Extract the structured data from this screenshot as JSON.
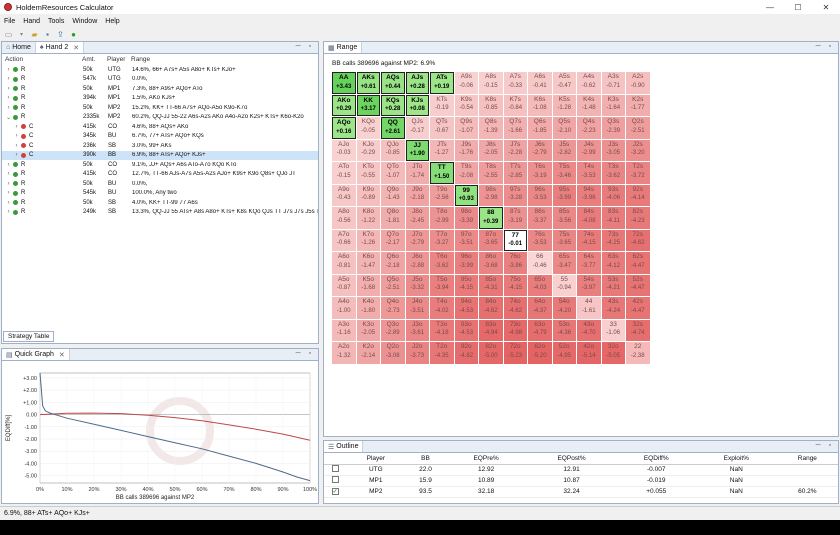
{
  "window": {
    "title": "HoldemResources Calculator",
    "min": "—",
    "max": "☐",
    "close": "✕"
  },
  "menu": [
    "File",
    "Hand",
    "Tools",
    "Window",
    "Help"
  ],
  "left_panel": {
    "tabs": [
      {
        "label": "Home"
      },
      {
        "label": "Hand 2"
      }
    ],
    "columns": [
      "Action",
      "Amt.",
      "Player",
      "Range"
    ],
    "rows": [
      {
        "exp": "›",
        "dot": "#3a9a3a",
        "action": "R",
        "amt": "50k",
        "player": "UTG",
        "range": "14.6%, 66+ A7s+ A5s A8o+ KTs+ KJo+",
        "depth": 0,
        "sel": false
      },
      {
        "exp": "›",
        "dot": "#3a9a3a",
        "action": "R",
        "amt": "547k",
        "player": "UTG",
        "range": "0.0%,",
        "depth": 0,
        "sel": false
      },
      {
        "exp": "›",
        "dot": "#3a9a3a",
        "action": "R",
        "amt": "50k",
        "player": "MP1",
        "range": "7.3%, 88+ A9s+ AQo+ ATo",
        "depth": 0,
        "sel": false
      },
      {
        "exp": "›",
        "dot": "#3a9a3a",
        "action": "R",
        "amt": "394k",
        "player": "MP1",
        "range": "1.5%, AKo KJs+",
        "depth": 0,
        "sel": false
      },
      {
        "exp": "›",
        "dot": "#3a9a3a",
        "action": "R",
        "amt": "50k",
        "player": "MP2",
        "range": "15.2%, KK+ TT-66 A7s+ AQo-A5o K9o-K7o",
        "depth": 0,
        "sel": false
      },
      {
        "exp": "⌄",
        "dot": "#3a9a3a",
        "action": "R",
        "amt": "2335k",
        "player": "MP2",
        "range": "60.2%, QQ-JJ 55-22 A6s-A2s AKo A4o-A2o K2s+ KTs+ K6o-K2o",
        "depth": 0,
        "sel": false
      },
      {
        "exp": "›",
        "dot": "#d04040",
        "action": "C",
        "amt": "415k",
        "player": "CO",
        "range": "4.6%, 88+ AQs+ AKo",
        "depth": 1,
        "sel": false
      },
      {
        "exp": "›",
        "dot": "#d04040",
        "action": "C",
        "amt": "345k",
        "player": "BU",
        "range": "6.7%, 77+ ATs+ AQo+ KQs",
        "depth": 1,
        "sel": false
      },
      {
        "exp": "›",
        "dot": "#d04040",
        "action": "C",
        "amt": "236k",
        "player": "SB",
        "range": "3.0%, 99+ AKs",
        "depth": 1,
        "sel": false
      },
      {
        "exp": "›",
        "dot": "#d04040",
        "action": "C",
        "amt": "390k",
        "player": "BB",
        "range": "6.9%, 88+ ATs+ AQo+ KJs+",
        "depth": 1,
        "sel": true
      },
      {
        "exp": "›",
        "dot": "#3a9a3a",
        "action": "R",
        "amt": "50k",
        "player": "CO",
        "range": "9.1%, JJ+ AQs+ A6s ATo-A7o KQo KTo",
        "depth": 0,
        "sel": false
      },
      {
        "exp": "›",
        "dot": "#3a9a3a",
        "action": "R",
        "amt": "415k",
        "player": "CO",
        "range": "12.7%, TT-66 AJs-A7s A5s-A2s AJo+ K9s+ K9o Q8s+ QJo JT",
        "depth": 0,
        "sel": false
      },
      {
        "exp": "›",
        "dot": "#3a9a3a",
        "action": "R",
        "amt": "50k",
        "player": "BU",
        "range": "0.0%,",
        "depth": 0,
        "sel": false
      },
      {
        "exp": "›",
        "dot": "#3a9a3a",
        "action": "R",
        "amt": "545k",
        "player": "BU",
        "range": "100.0%, Any two",
        "depth": 0,
        "sel": false
      },
      {
        "exp": "›",
        "dot": "#3a9a3a",
        "action": "R",
        "amt": "50k",
        "player": "SB",
        "range": "4.0%, KK+ TT-99 77 A6s",
        "depth": 0,
        "sel": false
      },
      {
        "exp": "›",
        "dot": "#3a9a3a",
        "action": "R",
        "amt": "249k",
        "player": "SB",
        "range": "13.3%, QQ-JJ 55 ATs+ A8s A8o+ KTs+ K8s KQo QJs TT J7s J7s J5s T8s",
        "depth": 0,
        "sel": false
      }
    ],
    "bottom_tab": "Strategy Table"
  },
  "quick_graph": {
    "tab": "Quick Graph",
    "chart_data": {
      "type": "line",
      "title": "",
      "xlabel": "BB calls 389696 against MP2",
      "ylabel": "EQDiff[%]",
      "x_ticks": [
        "0%",
        "10%",
        "20%",
        "30%",
        "40%",
        "50%",
        "60%",
        "70%",
        "80%",
        "90%",
        "100%"
      ],
      "y_ticks": [
        "+3.00",
        "+2.00",
        "+1.00",
        "0.00",
        "-1.00",
        "-2.00",
        "-3.00",
        "-4.00",
        "-5.00"
      ],
      "ylim": [
        -5.6,
        3.4
      ],
      "series": [
        {
          "color": "#c04848",
          "x": [
            0,
            10,
            20,
            30,
            40,
            50,
            60,
            70,
            80,
            90,
            100
          ],
          "y": [
            0.0,
            0.1,
            0.12,
            0.08,
            -0.05,
            -0.25,
            -0.5,
            -0.85,
            -1.2,
            -1.6,
            -2.1
          ]
        },
        {
          "color": "#4a6b8a",
          "x": [
            0,
            1,
            2,
            4,
            10,
            20,
            30,
            40,
            50,
            60,
            70,
            80,
            90,
            95,
            100
          ],
          "y": [
            3.4,
            0.7,
            0.3,
            0.1,
            -0.3,
            -0.8,
            -1.3,
            -1.8,
            -2.3,
            -2.8,
            -3.4,
            -4.0,
            -4.7,
            -5.1,
            -5.4
          ]
        }
      ]
    }
  },
  "range_panel": {
    "tab": "Range",
    "title": "BB calls 389696 against MP2: 6.9%",
    "grid": [
      [
        [
          "AA",
          "+3.43"
        ],
        [
          "AKs",
          "+0.61"
        ],
        [
          "AQs",
          "+0.44"
        ],
        [
          "AJs",
          "+0.28"
        ],
        [
          "ATs",
          "+0.19"
        ],
        [
          "A9s",
          "-0.06"
        ],
        [
          "A8s",
          "-0.15"
        ],
        [
          "A7s",
          "-0.33"
        ],
        [
          "A6s",
          "-0.41"
        ],
        [
          "A5s",
          "-0.47"
        ],
        [
          "A4s",
          "-0.62"
        ],
        [
          "A3s",
          "-0.71"
        ],
        [
          "A2s",
          "-0.90"
        ]
      ],
      [
        [
          "AKo",
          "+0.29"
        ],
        [
          "KK",
          "+3.17"
        ],
        [
          "KQs",
          "+0.28"
        ],
        [
          "KJs",
          "+0.08"
        ],
        [
          "KTs",
          "-0.19"
        ],
        [
          "K9s",
          "-0.54"
        ],
        [
          "K8s",
          "-0.85"
        ],
        [
          "K7s",
          "-0.84"
        ],
        [
          "K6s",
          "-1.08"
        ],
        [
          "K5s",
          "-1.28"
        ],
        [
          "K4s",
          "-1.48"
        ],
        [
          "K3s",
          "-1.64"
        ],
        [
          "K2s",
          "-1.77"
        ]
      ],
      [
        [
          "AQo",
          "+0.16"
        ],
        [
          "KQo",
          "-0.05"
        ],
        [
          "QQ",
          "+2.61"
        ],
        [
          "QJs",
          "-0.17"
        ],
        [
          "QTs",
          "-0.67"
        ],
        [
          "Q9s",
          "-1.07"
        ],
        [
          "Q8s",
          "-1.39"
        ],
        [
          "Q7s",
          "-1.66"
        ],
        [
          "Q6s",
          "-1.85"
        ],
        [
          "Q5s",
          "-2.10"
        ],
        [
          "Q4s",
          "-2.23"
        ],
        [
          "Q3s",
          "-2.39"
        ],
        [
          "Q2s",
          "-2.51"
        ]
      ],
      [
        [
          "AJo",
          "-0.03"
        ],
        [
          "KJo",
          "-0.29"
        ],
        [
          "QJo",
          "-0.85"
        ],
        [
          "JJ",
          "+1.90"
        ],
        [
          "JTs",
          "-1.27"
        ],
        [
          "J9s",
          "-1.76"
        ],
        [
          "J8s",
          "-2.05"
        ],
        [
          "J7s",
          "-2.28"
        ],
        [
          "J6s",
          "-2.79"
        ],
        [
          "J5s",
          "-2.82"
        ],
        [
          "J4s",
          "-2.99"
        ],
        [
          "J3s",
          "-3.05"
        ],
        [
          "J2s",
          "-3.20"
        ]
      ],
      [
        [
          "ATo",
          "-0.15"
        ],
        [
          "KTo",
          "-0.55"
        ],
        [
          "QTo",
          "-1.07"
        ],
        [
          "JTo",
          "-1.74"
        ],
        [
          "TT",
          "+1.50"
        ],
        [
          "T9s",
          "-2.08"
        ],
        [
          "T8s",
          "-2.55"
        ],
        [
          "T7s",
          "-2.85"
        ],
        [
          "T6s",
          "-3.19"
        ],
        [
          "T5s",
          "-3.46"
        ],
        [
          "T4s",
          "-3.53"
        ],
        [
          "T3s",
          "-3.62"
        ],
        [
          "T2s",
          "-3.72"
        ]
      ],
      [
        [
          "A9o",
          "-0.43"
        ],
        [
          "K9o",
          "-0.89"
        ],
        [
          "Q9o",
          "-1.43"
        ],
        [
          "J9o",
          "-2.18"
        ],
        [
          "T9o",
          "-2.56"
        ],
        [
          "99",
          "+0.93"
        ],
        [
          "98s",
          "-2.98"
        ],
        [
          "97s",
          "-3.28"
        ],
        [
          "96s",
          "-3.53"
        ],
        [
          "95s",
          "-3.99"
        ],
        [
          "94s",
          "-3.96"
        ],
        [
          "93s",
          "-4.06"
        ],
        [
          "92s",
          "-4.14"
        ]
      ],
      [
        [
          "A8o",
          "-0.56"
        ],
        [
          "K8o",
          "-1.22"
        ],
        [
          "Q8o",
          "-1.81"
        ],
        [
          "J8o",
          "-2.45"
        ],
        [
          "T8o",
          "-2.99"
        ],
        [
          "98o",
          "-3.39"
        ],
        [
          "88",
          "+0.39"
        ],
        [
          "87s",
          "-3.19"
        ],
        [
          "86s",
          "-3.37"
        ],
        [
          "85s",
          "-3.56"
        ],
        [
          "84s",
          "-4.08"
        ],
        [
          "83s",
          "-4.11"
        ],
        [
          "82s",
          "-4.23"
        ]
      ],
      [
        [
          "A7o",
          "-0.66"
        ],
        [
          "K7o",
          "-1.26"
        ],
        [
          "Q7o",
          "-2.17"
        ],
        [
          "J7o",
          "-2.79"
        ],
        [
          "T7o",
          "-3.27"
        ],
        [
          "97o",
          "-3.51"
        ],
        [
          "87o",
          "-3.65"
        ],
        [
          "77",
          "-0.01"
        ],
        [
          "76s",
          "-3.53"
        ],
        [
          "75s",
          "-3.65"
        ],
        [
          "74s",
          "-4.15"
        ],
        [
          "73s",
          "-4.25"
        ],
        [
          "72s",
          "-4.62"
        ]
      ],
      [
        [
          "A6o",
          "-0.81"
        ],
        [
          "K6o",
          "-1.47"
        ],
        [
          "Q6o",
          "-2.18"
        ],
        [
          "J6o",
          "-2.88"
        ],
        [
          "T6o",
          "-3.62"
        ],
        [
          "96o",
          "-3.99"
        ],
        [
          "86o",
          "-3.68"
        ],
        [
          "76o",
          "-3.86"
        ],
        [
          "66",
          "-0.46"
        ],
        [
          "65s",
          "-3.47"
        ],
        [
          "64s",
          "-3.77"
        ],
        [
          "63s",
          "-4.12"
        ],
        [
          "62s",
          "-4.47"
        ]
      ],
      [
        [
          "A5o",
          "-0.87"
        ],
        [
          "K5o",
          "-1.68"
        ],
        [
          "Q5o",
          "-2.51"
        ],
        [
          "J5o",
          "-3.32"
        ],
        [
          "T5o",
          "-3.94"
        ],
        [
          "95o",
          "-4.15"
        ],
        [
          "85o",
          "-4.31"
        ],
        [
          "75o",
          "-4.15"
        ],
        [
          "65o",
          "-4.03"
        ],
        [
          "55",
          "-0.94"
        ],
        [
          "54s",
          "-3.97"
        ],
        [
          "53s",
          "-4.21"
        ],
        [
          "52s",
          "-4.47"
        ]
      ],
      [
        [
          "A4o",
          "-1.00"
        ],
        [
          "K4o",
          "-1.80"
        ],
        [
          "Q4o",
          "-2.73"
        ],
        [
          "J4o",
          "-3.51"
        ],
        [
          "T4o",
          "-4.02"
        ],
        [
          "94o",
          "-4.53"
        ],
        [
          "84o",
          "-4.62"
        ],
        [
          "74o",
          "-4.62"
        ],
        [
          "64o",
          "-4.37"
        ],
        [
          "54o",
          "-4.20"
        ],
        [
          "44",
          "-1.61"
        ],
        [
          "43s",
          "-4.24"
        ],
        [
          "42s",
          "-4.47"
        ]
      ],
      [
        [
          "A3o",
          "-1.16"
        ],
        [
          "K3o",
          "-2.05"
        ],
        [
          "Q3o",
          "-2.89"
        ],
        [
          "J3o",
          "-3.61"
        ],
        [
          "T3o",
          "-4.18"
        ],
        [
          "93o",
          "-4.53"
        ],
        [
          "83o",
          "-4.94"
        ],
        [
          "73o",
          "-4.98"
        ],
        [
          "63o",
          "-4.79"
        ],
        [
          "53o",
          "-4.36"
        ],
        [
          "43o",
          "-4.70"
        ],
        [
          "33",
          "-1.06"
        ],
        [
          "32s",
          "-4.74"
        ]
      ],
      [
        [
          "A2o",
          "-1.32"
        ],
        [
          "K2o",
          "-2.14"
        ],
        [
          "Q2o",
          "-3.08"
        ],
        [
          "J2o",
          "-3.73"
        ],
        [
          "T2o",
          "-4.35"
        ],
        [
          "92o",
          "-4.82"
        ],
        [
          "82o",
          "-5.00"
        ],
        [
          "72o",
          "-5.23"
        ],
        [
          "62o",
          "-5.20"
        ],
        [
          "52o",
          "-4.95"
        ],
        [
          "42o",
          "-5.14"
        ],
        [
          "32o",
          "-5.05"
        ],
        [
          "22",
          "-2.38"
        ]
      ]
    ],
    "selected": [
      "AA",
      "AKs",
      "AQs",
      "AJs",
      "ATs",
      "AKo",
      "KK",
      "KQs",
      "KJs",
      "AQo",
      "QQ",
      "JJ",
      "TT",
      "99",
      "88"
    ],
    "highlighted": [
      "77"
    ]
  },
  "outline": {
    "tab": "Outline",
    "columns": [
      "",
      "Player",
      "BB",
      "EQPre%",
      "EQPost%",
      "EQDiff%",
      "Exploit%",
      "Range"
    ],
    "rows": [
      {
        "checked": false,
        "player": "UTG",
        "bb": "22.0",
        "eqpre": "12.92",
        "eqpost": "12.91",
        "eqdiff": "-0.007",
        "exploit": "NaN",
        "range": ""
      },
      {
        "checked": false,
        "player": "MP1",
        "bb": "15.9",
        "eqpre": "10.89",
        "eqpost": "10.87",
        "eqdiff": "-0.019",
        "exploit": "NaN",
        "range": ""
      },
      {
        "checked": true,
        "player": "MP2",
        "bb": "93.5",
        "eqpre": "32.18",
        "eqpost": "32.24",
        "eqdiff": "+0.055",
        "exploit": "NaN",
        "range": "60.2%"
      }
    ]
  },
  "status": {
    "text": "6.9%, 88+ ATs+ AQo+ KJs+"
  }
}
